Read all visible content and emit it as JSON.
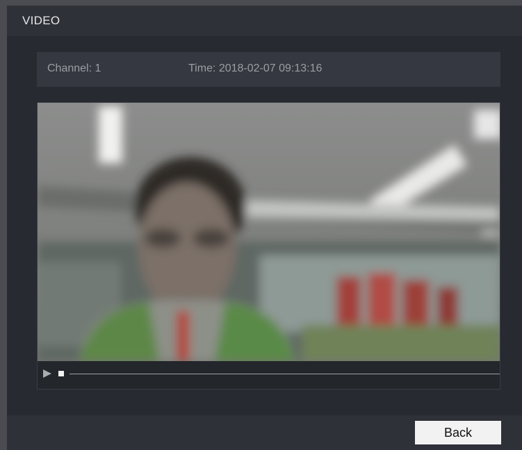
{
  "window": {
    "title": "VIDEO"
  },
  "info": {
    "channel": "Channel: 1",
    "time": "Time: 2018-02-07 09:13:16"
  },
  "player": {
    "controls": {
      "play_icon": "play-icon",
      "stop_icon": "stop-icon"
    },
    "progress": 0
  },
  "footer": {
    "back_label": "Back"
  }
}
